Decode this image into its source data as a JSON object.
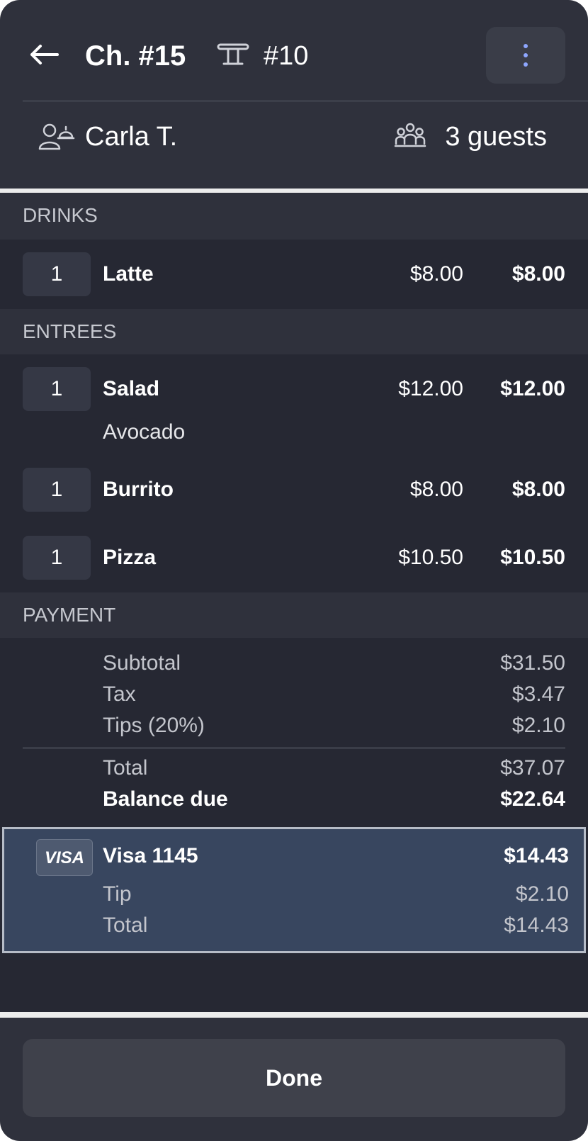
{
  "header": {
    "back_icon": "arrow-left-icon",
    "check_title": "Ch. #15",
    "table_icon": "table-icon",
    "table_number": "#10",
    "more_icon": "more-vertical-icon",
    "server_icon": "server-icon",
    "server_name": "Carla T.",
    "guests_icon": "guests-icon",
    "guests_label": "3 guests"
  },
  "sections": {
    "drinks": "DRINKS",
    "entrees": "ENTREES",
    "payment": "PAYMENT"
  },
  "drinks": [
    {
      "qty": "1",
      "name": "Latte",
      "price": "$8.00",
      "amount": "$8.00"
    }
  ],
  "entrees": [
    {
      "qty": "1",
      "name": "Salad",
      "price": "$12.00",
      "amount": "$12.00",
      "modifier": "Avocado"
    },
    {
      "qty": "1",
      "name": "Burrito",
      "price": "$8.00",
      "amount": "$8.00"
    },
    {
      "qty": "1",
      "name": "Pizza",
      "price": "$10.50",
      "amount": "$10.50"
    }
  ],
  "payment": {
    "subtotal_label": "Subtotal",
    "subtotal": "$31.50",
    "tax_label": "Tax",
    "tax": "$3.47",
    "tips_label": "Tips (20%)",
    "tips": "$2.10",
    "total_label": "Total",
    "total": "$37.07",
    "balance_label": "Balance due",
    "balance": "$22.64"
  },
  "card": {
    "brand": "VISA",
    "name": "Visa 1145",
    "amount": "$14.43",
    "tip_label": "Tip",
    "tip": "$2.10",
    "total_label": "Total",
    "total": "$14.43"
  },
  "footer": {
    "done_label": "Done"
  },
  "colors": {
    "panel": "#2f313c",
    "body": "#262833",
    "card_selected": "#38465f",
    "accent": "#8ea7ff"
  }
}
